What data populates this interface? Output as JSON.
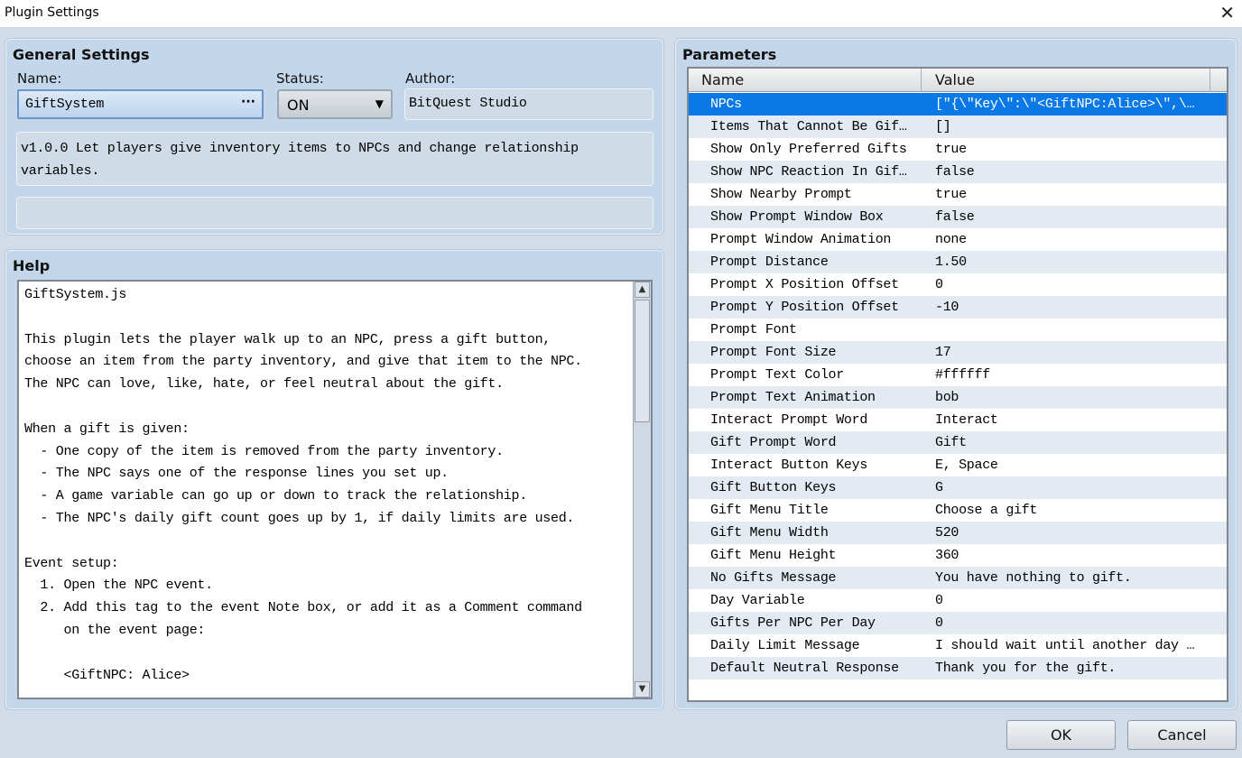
{
  "window": {
    "title": "Plugin Settings",
    "close": "✕"
  },
  "general": {
    "title": "General Settings",
    "name_label": "Name:",
    "name_value": "GiftSystem",
    "name_more": "···",
    "status_label": "Status:",
    "status_value": "ON",
    "status_arrow": "▼",
    "author_label": "Author:",
    "author_value": "BitQuest Studio",
    "description": "v1.0.0 Let players give inventory items to NPCs and change relationship\nvariables."
  },
  "help": {
    "title": "Help",
    "text": "GiftSystem.js\n\nThis plugin lets the player walk up to an NPC, press a gift button,\nchoose an item from the party inventory, and give that item to the NPC.\nThe NPC can love, like, hate, or feel neutral about the gift.\n\nWhen a gift is given:\n  - One copy of the item is removed from the party inventory.\n  - The NPC says one of the response lines you set up.\n  - A game variable can go up or down to track the relationship.\n  - The NPC's daily gift count goes up by 1, if daily limits are used.\n\nEvent setup:\n  1. Open the NPC event.\n  2. Add this tag to the event Note box, or add it as a Comment command\n     on the event page:\n\n     <GiftNPC: Alice>"
  },
  "parameters": {
    "title": "Parameters",
    "col_name": "Name",
    "col_value": "Value",
    "rows": [
      {
        "name": "NPCs",
        "value": "[\"{\\\"Key\\\":\\\"<GiftNPC:Alice>\\\",\\…"
      },
      {
        "name": "Items That Cannot Be Gif…",
        "value": "[]"
      },
      {
        "name": "Show Only Preferred Gifts",
        "value": "true"
      },
      {
        "name": "Show NPC Reaction In Gif…",
        "value": "false"
      },
      {
        "name": "Show Nearby Prompt",
        "value": "true"
      },
      {
        "name": "Show Prompt Window Box",
        "value": "false"
      },
      {
        "name": "Prompt Window Animation",
        "value": "none"
      },
      {
        "name": "Prompt Distance",
        "value": "1.50"
      },
      {
        "name": "Prompt X Position Offset",
        "value": "0"
      },
      {
        "name": "Prompt Y Position Offset",
        "value": "-10"
      },
      {
        "name": "Prompt Font",
        "value": ""
      },
      {
        "name": "Prompt Font Size",
        "value": "17"
      },
      {
        "name": "Prompt Text Color",
        "value": "#ffffff"
      },
      {
        "name": "Prompt Text Animation",
        "value": "bob"
      },
      {
        "name": "Interact Prompt Word",
        "value": "Interact"
      },
      {
        "name": "Gift Prompt Word",
        "value": "Gift"
      },
      {
        "name": "Interact Button Keys",
        "value": "E, Space"
      },
      {
        "name": "Gift Button Keys",
        "value": "G"
      },
      {
        "name": "Gift Menu Title",
        "value": "Choose a gift"
      },
      {
        "name": "Gift Menu Width",
        "value": "520"
      },
      {
        "name": "Gift Menu Height",
        "value": "360"
      },
      {
        "name": "No Gifts Message",
        "value": "You have nothing to gift."
      },
      {
        "name": "Day Variable",
        "value": "0"
      },
      {
        "name": "Gifts Per NPC Per Day",
        "value": "0"
      },
      {
        "name": "Daily Limit Message",
        "value": "I should wait until another day …"
      },
      {
        "name": "Default Neutral Response",
        "value": "Thank you for the gift."
      }
    ]
  },
  "buttons": {
    "ok": "OK",
    "cancel": "Cancel"
  }
}
